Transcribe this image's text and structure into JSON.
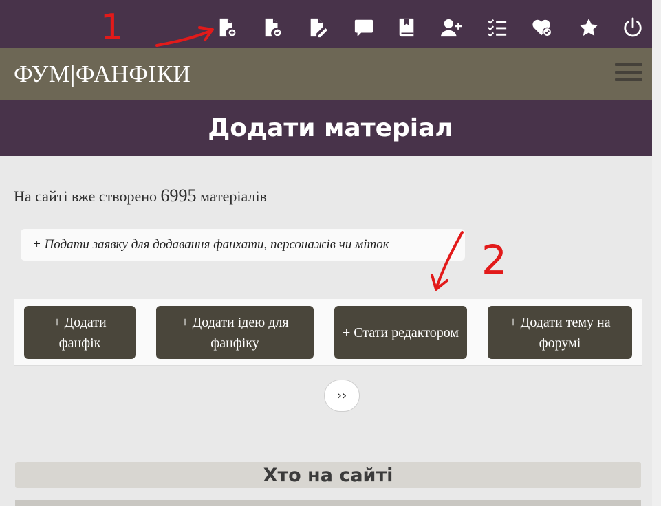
{
  "toolbar": {
    "icons": [
      {
        "name": "file-add-icon"
      },
      {
        "name": "file-check-icon"
      },
      {
        "name": "file-edit-icon"
      },
      {
        "name": "comment-icon"
      },
      {
        "name": "bookmark-book-icon"
      },
      {
        "name": "user-add-icon"
      },
      {
        "name": "checklist-icon"
      },
      {
        "name": "heart-check-icon"
      },
      {
        "name": "star-icon"
      },
      {
        "name": "power-icon"
      }
    ],
    "icon_color": "#ffffff",
    "background": "#48334a"
  },
  "brand": {
    "title": "ФУМ|ФАНФІКИ",
    "background": "#6d6755"
  },
  "page": {
    "title": "Додати матеріал",
    "count_prefix": "На сайті вже створено",
    "count_value": "6995",
    "count_suffix": "матеріалів"
  },
  "request_link": "+ Подати заявку для додавання фанхати, персонажів чи міток",
  "actions": [
    {
      "label": "+ Додати фанфік"
    },
    {
      "label": "+ Додати ідею для фанфіку"
    },
    {
      "label": "+ Стати редактором"
    },
    {
      "label": "+ Додати тему на форумі"
    }
  ],
  "next_label": "››",
  "who_online": "Хто на сайті",
  "annotations": {
    "mark_1": "1",
    "mark_2": "2",
    "color": "#e21a1a"
  }
}
